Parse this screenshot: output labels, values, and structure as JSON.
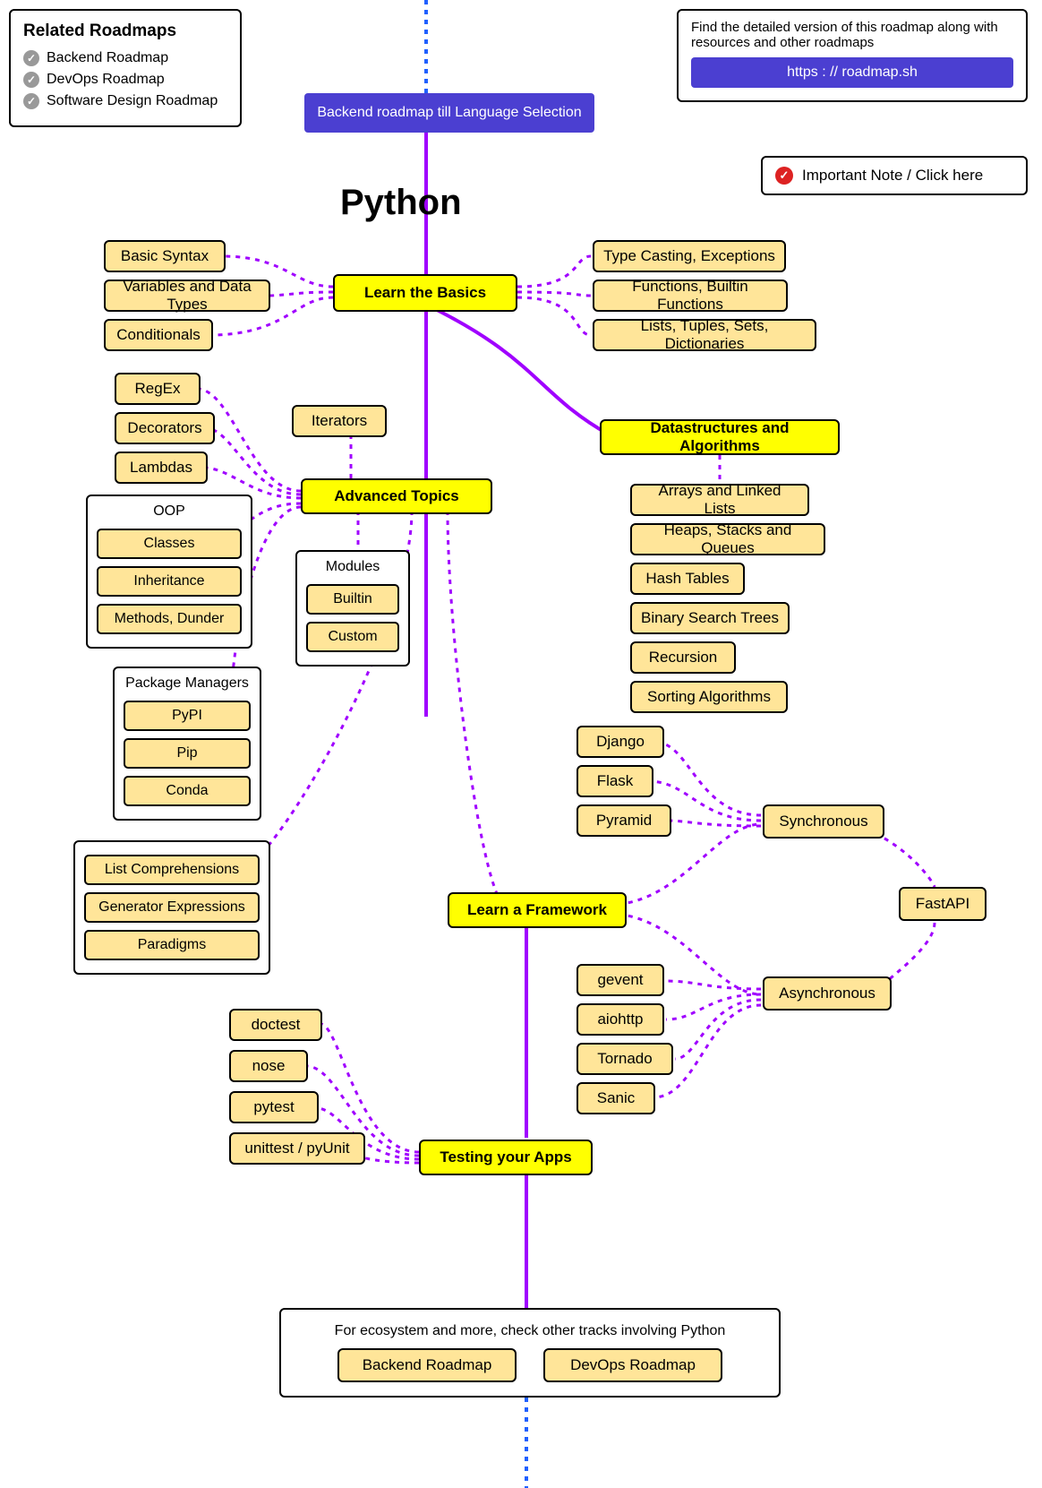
{
  "related": {
    "title": "Related Roadmaps",
    "items": [
      "Backend Roadmap",
      "DevOps Roadmap",
      "Software Design Roadmap"
    ]
  },
  "header": {
    "backend_link": "Backend roadmap till Language Selection",
    "info_text": "Find the detailed version of this roadmap along with resources and other roadmaps",
    "info_link": "https : // roadmap.sh",
    "note_label": "Important Note / Click here"
  },
  "title": "Python",
  "basics": {
    "title": "Learn the Basics",
    "left": [
      "Basic Syntax",
      "Variables and Data Types",
      "Conditionals"
    ],
    "right": [
      "Type Casting, Exceptions",
      "Functions, Builtin Functions",
      "Lists, Tuples, Sets, Dictionaries"
    ]
  },
  "dsa": {
    "title": "Datastructures and Algorithms",
    "items": [
      "Arrays and Linked Lists",
      "Heaps, Stacks and Queues",
      "Hash Tables",
      "Binary Search Trees",
      "Recursion",
      "Sorting Algorithms"
    ]
  },
  "advanced": {
    "title": "Advanced Topics",
    "left": [
      "RegEx",
      "Decorators",
      "Lambdas"
    ],
    "iterators": "Iterators",
    "oop": {
      "title": "OOP",
      "items": [
        "Classes",
        "Inheritance",
        "Methods, Dunder"
      ]
    },
    "modules": {
      "title": "Modules",
      "items": [
        "Builtin",
        "Custom"
      ]
    },
    "extras": [
      "List Comprehensions",
      "Generator Expressions",
      "Paradigms"
    ]
  },
  "pkgmgr": {
    "title": "Package Managers",
    "items": [
      "PyPI",
      "Pip",
      "Conda"
    ]
  },
  "framework": {
    "title": "Learn a Framework",
    "sync_label": "Synchronous",
    "async_label": "Asynchronous",
    "sync": [
      "Django",
      "Flask",
      "Pyramid"
    ],
    "fastapi": "FastAPI",
    "async": [
      "gevent",
      "aiohttp",
      "Tornado",
      "Sanic"
    ]
  },
  "testing": {
    "title": "Testing your Apps",
    "items": [
      "doctest",
      "nose",
      "pytest",
      "unittest / pyUnit"
    ]
  },
  "footer": {
    "text": "For ecosystem and more, check other tracks involving Python",
    "links": [
      "Backend Roadmap",
      "DevOps Roadmap"
    ]
  },
  "colors": {
    "purple": "#a000ff",
    "blue": "#2060ff"
  }
}
